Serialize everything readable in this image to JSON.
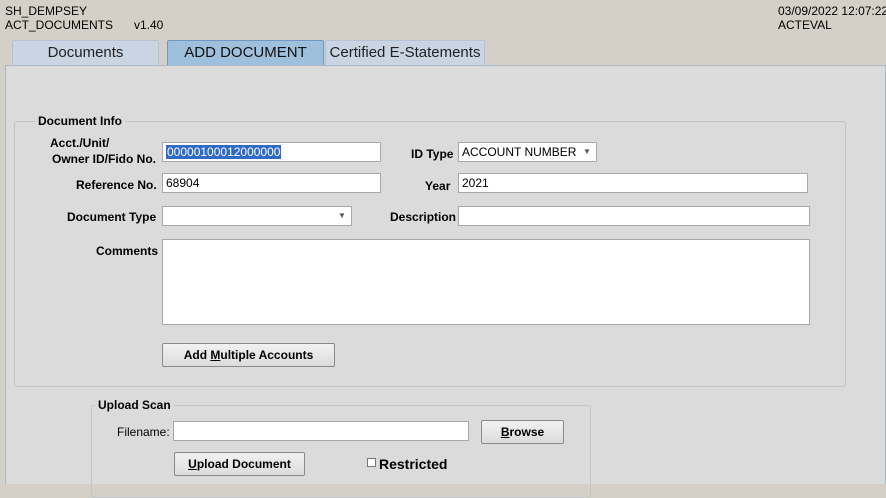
{
  "header": {
    "user": "SH_DEMPSEY",
    "module": "ACT_DOCUMENTS",
    "version": "v1.40",
    "datetime": "03/09/2022 12:07:22",
    "environment": "ACTEVAL"
  },
  "tabs": [
    {
      "label": "Documents",
      "active": false
    },
    {
      "label": "ADD DOCUMENT",
      "active": true
    },
    {
      "label": "Certified E-Statements",
      "active": false
    }
  ],
  "document_info": {
    "title": "Document Info",
    "acct_label_line1": "Acct./Unit/",
    "acct_label_line2": "Owner ID/Fido No.",
    "acct_value": "00000100012000000",
    "id_type_label": "ID Type",
    "id_type_value": "ACCOUNT NUMBER",
    "reference_label": "Reference No.",
    "reference_value": "68904",
    "year_label": "Year",
    "year_value": "2021",
    "document_type_label": "Document Type",
    "document_type_value": "",
    "description_label": "Description",
    "description_value": "",
    "comments_label": "Comments",
    "comments_value": "",
    "add_multiple": {
      "pre": "Add ",
      "accel": "M",
      "post": "ultiple Accounts"
    }
  },
  "upload_scan": {
    "title": "Upload Scan",
    "filename_label": "Filename:",
    "filename_value": "",
    "browse": {
      "accel": "B",
      "post": "rowse"
    },
    "upload": {
      "accel": "U",
      "post": "pload Document"
    },
    "restricted_label": "Restricted",
    "restricted_checked": false
  }
}
